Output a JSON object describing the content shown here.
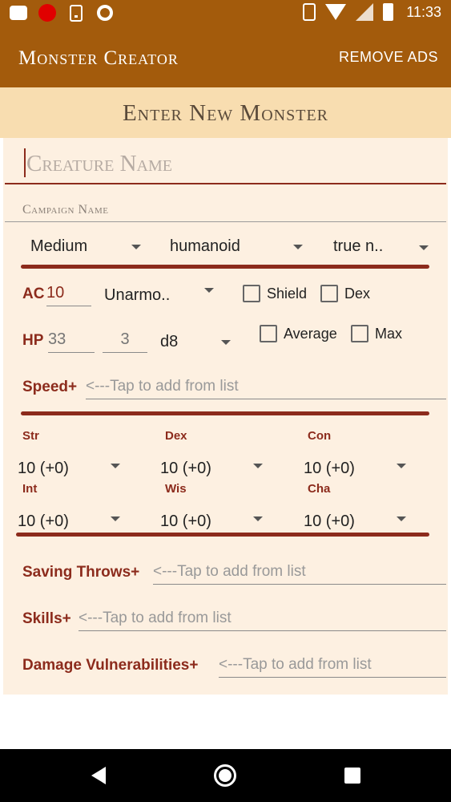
{
  "status_bar": {
    "time": "11:33",
    "icons": [
      "cloud-icon",
      "red-circle-icon",
      "download-icon",
      "ring-icon",
      "vibrate-icon",
      "wifi-icon",
      "signal-icon",
      "battery-icon"
    ]
  },
  "app_bar": {
    "title": "Monster Creator",
    "remove_ads": "REMOVE ADS"
  },
  "section": {
    "title": "Enter New Monster"
  },
  "form": {
    "creature_name_placeholder": "Creature Name",
    "campaign_name_placeholder": "Campaign Name",
    "size": "Medium",
    "type": "humanoid",
    "alignment": "true n..",
    "ac_label": "AC",
    "ac_value": "10",
    "armor": "Unarmo..",
    "shield_label": "Shield",
    "dex_label": "Dex",
    "hp_label": "HP",
    "hp_placeholder": "33",
    "hit_dice_placeholder": "3",
    "die": "d8",
    "average_label": "Average",
    "max_label": "Max",
    "speed_label": "Speed+",
    "speed_placeholder": "<---Tap to add from list",
    "abilities": [
      {
        "name": "Str",
        "value": "10 (+0)"
      },
      {
        "name": "Dex",
        "value": "10 (+0)"
      },
      {
        "name": "Con",
        "value": "10 (+0)"
      },
      {
        "name": "Int",
        "value": "10 (+0)"
      },
      {
        "name": "Wis",
        "value": "10 (+0)"
      },
      {
        "name": "Cha",
        "value": "10 (+0)"
      }
    ],
    "saving_throws_label": "Saving Throws+",
    "saving_throws_placeholder": "<---Tap to add from list",
    "skills_label": "Skills+",
    "skills_placeholder": "<---Tap to add from list",
    "damage_vuln_label": "Damage Vulnerabilities+",
    "damage_vuln_placeholder": "<---Tap to add from list"
  },
  "colors": {
    "app_bar": "#a35b0c",
    "section_header": "#f8ddb0",
    "panel": "#fdf0e1",
    "accent": "#8c2b1c"
  }
}
